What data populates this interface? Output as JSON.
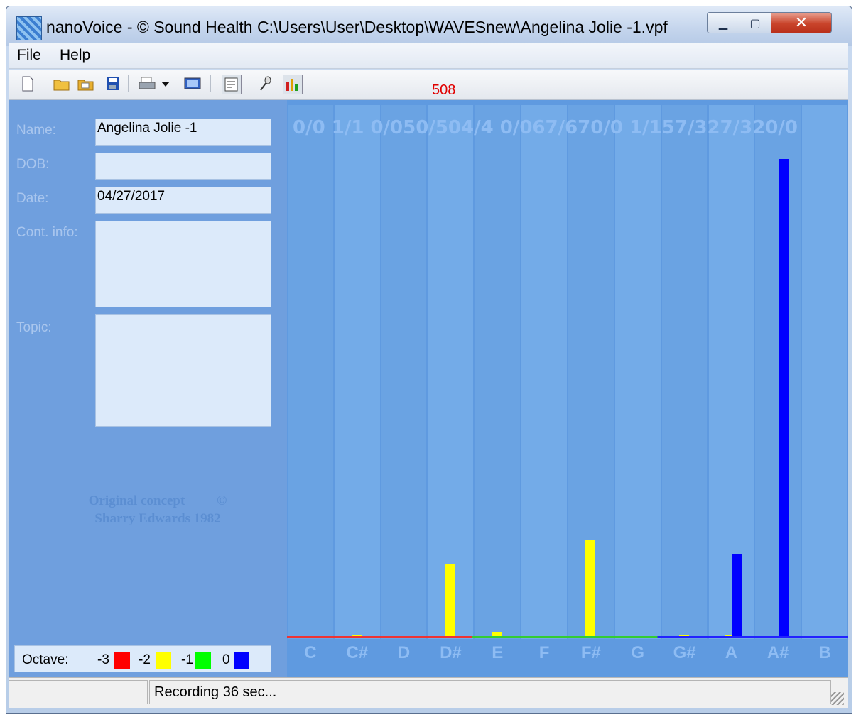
{
  "window": {
    "title": "nanoVoice - © Sound Health C:\\Users\\User\\Desktop\\WAVESnew\\Angelina Jolie -1.vpf"
  },
  "menu": {
    "items": [
      "File",
      "Help"
    ]
  },
  "toolbar": {
    "icons": [
      "new-file-icon",
      "open-folder-icon",
      "open-recent-icon",
      "save-icon",
      "print-icon",
      "dropdown-arrow-icon",
      "screen-icon",
      "report-icon",
      "microphone-icon",
      "bar-chart-icon"
    ],
    "counter": "508"
  },
  "form": {
    "name_label": "Name:",
    "name_value": "Angelina Jolie -1",
    "dob_label": "DOB:",
    "dob_value": "",
    "date_label": "Date:",
    "date_value": "04/27/2017",
    "contact_label": "Cont. info:",
    "contact_value": "",
    "topic_label": "Topic:",
    "topic_value": ""
  },
  "watermark": {
    "line1": "Original concept",
    "symbol": "©",
    "line2": "Sharry Edwards 1982"
  },
  "legend": {
    "label": "Octave:",
    "entries": [
      {
        "num": "-3",
        "color": "#ff0000"
      },
      {
        "num": "-2",
        "color": "#ffff00"
      },
      {
        "num": "-1",
        "color": "#00ff00"
      },
      {
        "num": "0",
        "color": "#0000ff"
      }
    ]
  },
  "chart_data": {
    "type": "bar",
    "top_labels": "0/0 1/1 0/050/504/4 0/067/670/0 1/157/327/320/0",
    "categories": [
      "C",
      "C#",
      "D",
      "D#",
      "E",
      "F",
      "F#",
      "G",
      "G#",
      "A",
      "A#",
      "B"
    ],
    "bar_colors": {
      "yellow": "#ffff00",
      "blue": "#0000ff"
    },
    "series": [
      {
        "octave": "-2",
        "color": "#ffff00",
        "values": [
          0,
          1,
          0,
          50,
          4,
          0,
          67,
          0,
          1,
          1,
          0,
          0
        ]
      },
      {
        "octave": "0",
        "color": "#0000ff",
        "values": [
          0,
          0,
          0,
          0,
          0,
          0,
          0,
          0,
          0,
          57,
          327,
          0
        ]
      }
    ],
    "ymax": 327
  },
  "status": {
    "left": "",
    "right": "Recording 36 sec..."
  }
}
